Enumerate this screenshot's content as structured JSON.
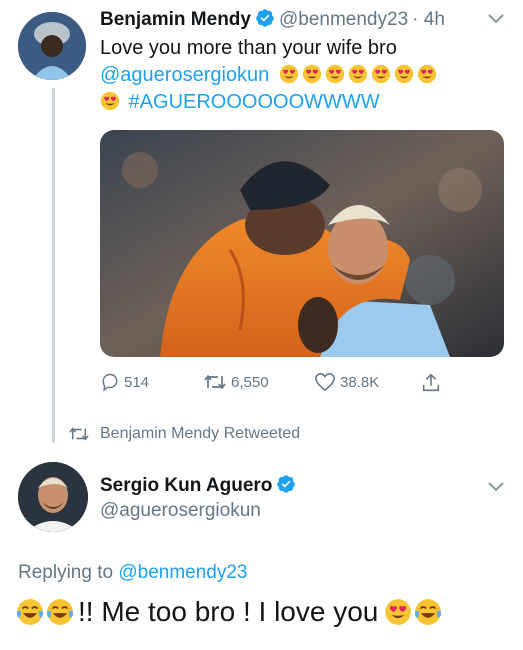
{
  "tweet1": {
    "name": "Benjamin Mendy",
    "handle": "@benmendy23",
    "time": "· 4h",
    "text_line1": "Love you more than your wife bro",
    "mention": "@aguerosergiokun",
    "hashtag": "#AGUEROOOOOOWWWW",
    "heart_eyes_count": 8,
    "actions": {
      "replies": "514",
      "retweets": "6,550",
      "likes": "38.8K"
    }
  },
  "retweet_context": {
    "label": "Benjamin Mendy Retweeted"
  },
  "tweet2": {
    "name": "Sergio Kun Aguero",
    "handle": "@aguerosergiokun",
    "replying_prefix": "Replying to",
    "replying_to": "@benmendy23",
    "text": "!! Me too bro ! I love you"
  },
  "colors": {
    "accent": "#1da1f2",
    "muted": "#657786",
    "text": "#14171a",
    "thread_line": "#cfd6dc"
  },
  "icons": [
    "verified-icon",
    "chevron-down-icon",
    "reply-icon",
    "retweet-icon",
    "like-icon",
    "share-icon",
    "heart-eyes-emoji",
    "tears-of-joy-emoji"
  ]
}
